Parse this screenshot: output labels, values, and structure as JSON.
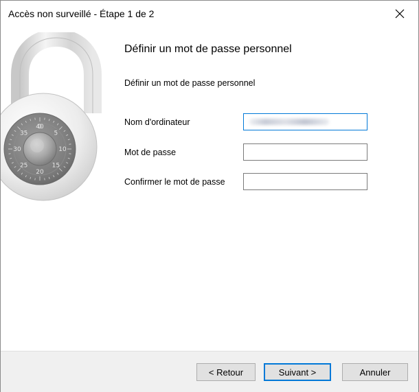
{
  "window": {
    "title": "Accès non surveillé - Étape 1 de 2"
  },
  "main": {
    "heading": "Définir un mot de passe personnel",
    "subheading": "Définir un mot de passe personnel",
    "fields": {
      "computer_name": {
        "label": "Nom d'ordinateur",
        "value": ""
      },
      "password": {
        "label": "Mot de passe",
        "value": ""
      },
      "confirm_password": {
        "label": "Confirmer le mot de passe",
        "value": ""
      }
    }
  },
  "lock_dial_numbers": [
    "0",
    "5",
    "10",
    "15",
    "20",
    "25",
    "30",
    "35",
    "40"
  ],
  "footer": {
    "back_label": "< Retour",
    "next_label": "Suivant >",
    "cancel_label": "Annuler"
  },
  "colors": {
    "accent": "#0078d7",
    "footer_bg": "#f0f0f0",
    "button_bg": "#e1e1e1"
  }
}
